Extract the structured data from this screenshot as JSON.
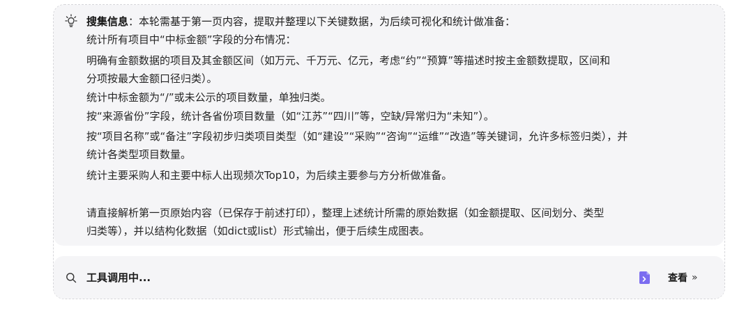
{
  "info": {
    "heading_strong": "搜集信息",
    "heading_rest": "：本轮需基于第一页内容，提取并整理以下关键数据，为后续可视化和统计做准备：",
    "lines": [
      "统计所有项目中“中标金额”字段的分布情况：",
      "明确有金额数据的项目及其金额区间（如万元、千万元、亿元，考虑“约”“预算”等描述时按主金额数提取，区间和",
      "分项按最大金额口径归类）。",
      "统计中标金额为“/”或未公示的项目数量，单独归类。",
      "按“来源省份”字段，统计各省份项目数量（如“江苏”“四川”等，空缺/异常归为“未知”）。",
      "按“项目名称”或“备注”字段初步归类项目类型（如“建设”“采购”“咨询”“运维”“改造”等关键词，允许多标签归类），并",
      "统计各类型项目数量。",
      "统计主要采购人和主要中标人出现频次Top10，为后续主要参与方分析做准备。"
    ],
    "instruction_lines": [
      "请直接解析第一页原始内容（已保存于前述打印），整理上述统计所需的原始数据（如金额提取、区间划分、类型",
      "归类等），并以结构化数据（如dict或list）形式输出，便于后续生成图表。"
    ]
  },
  "tool": {
    "status": "工具调用中...",
    "view_label": "查看",
    "view_chevron": "»"
  },
  "colors": {
    "panel_bg": "#f5f5f7",
    "doc_icon": "#7b6cf0"
  }
}
